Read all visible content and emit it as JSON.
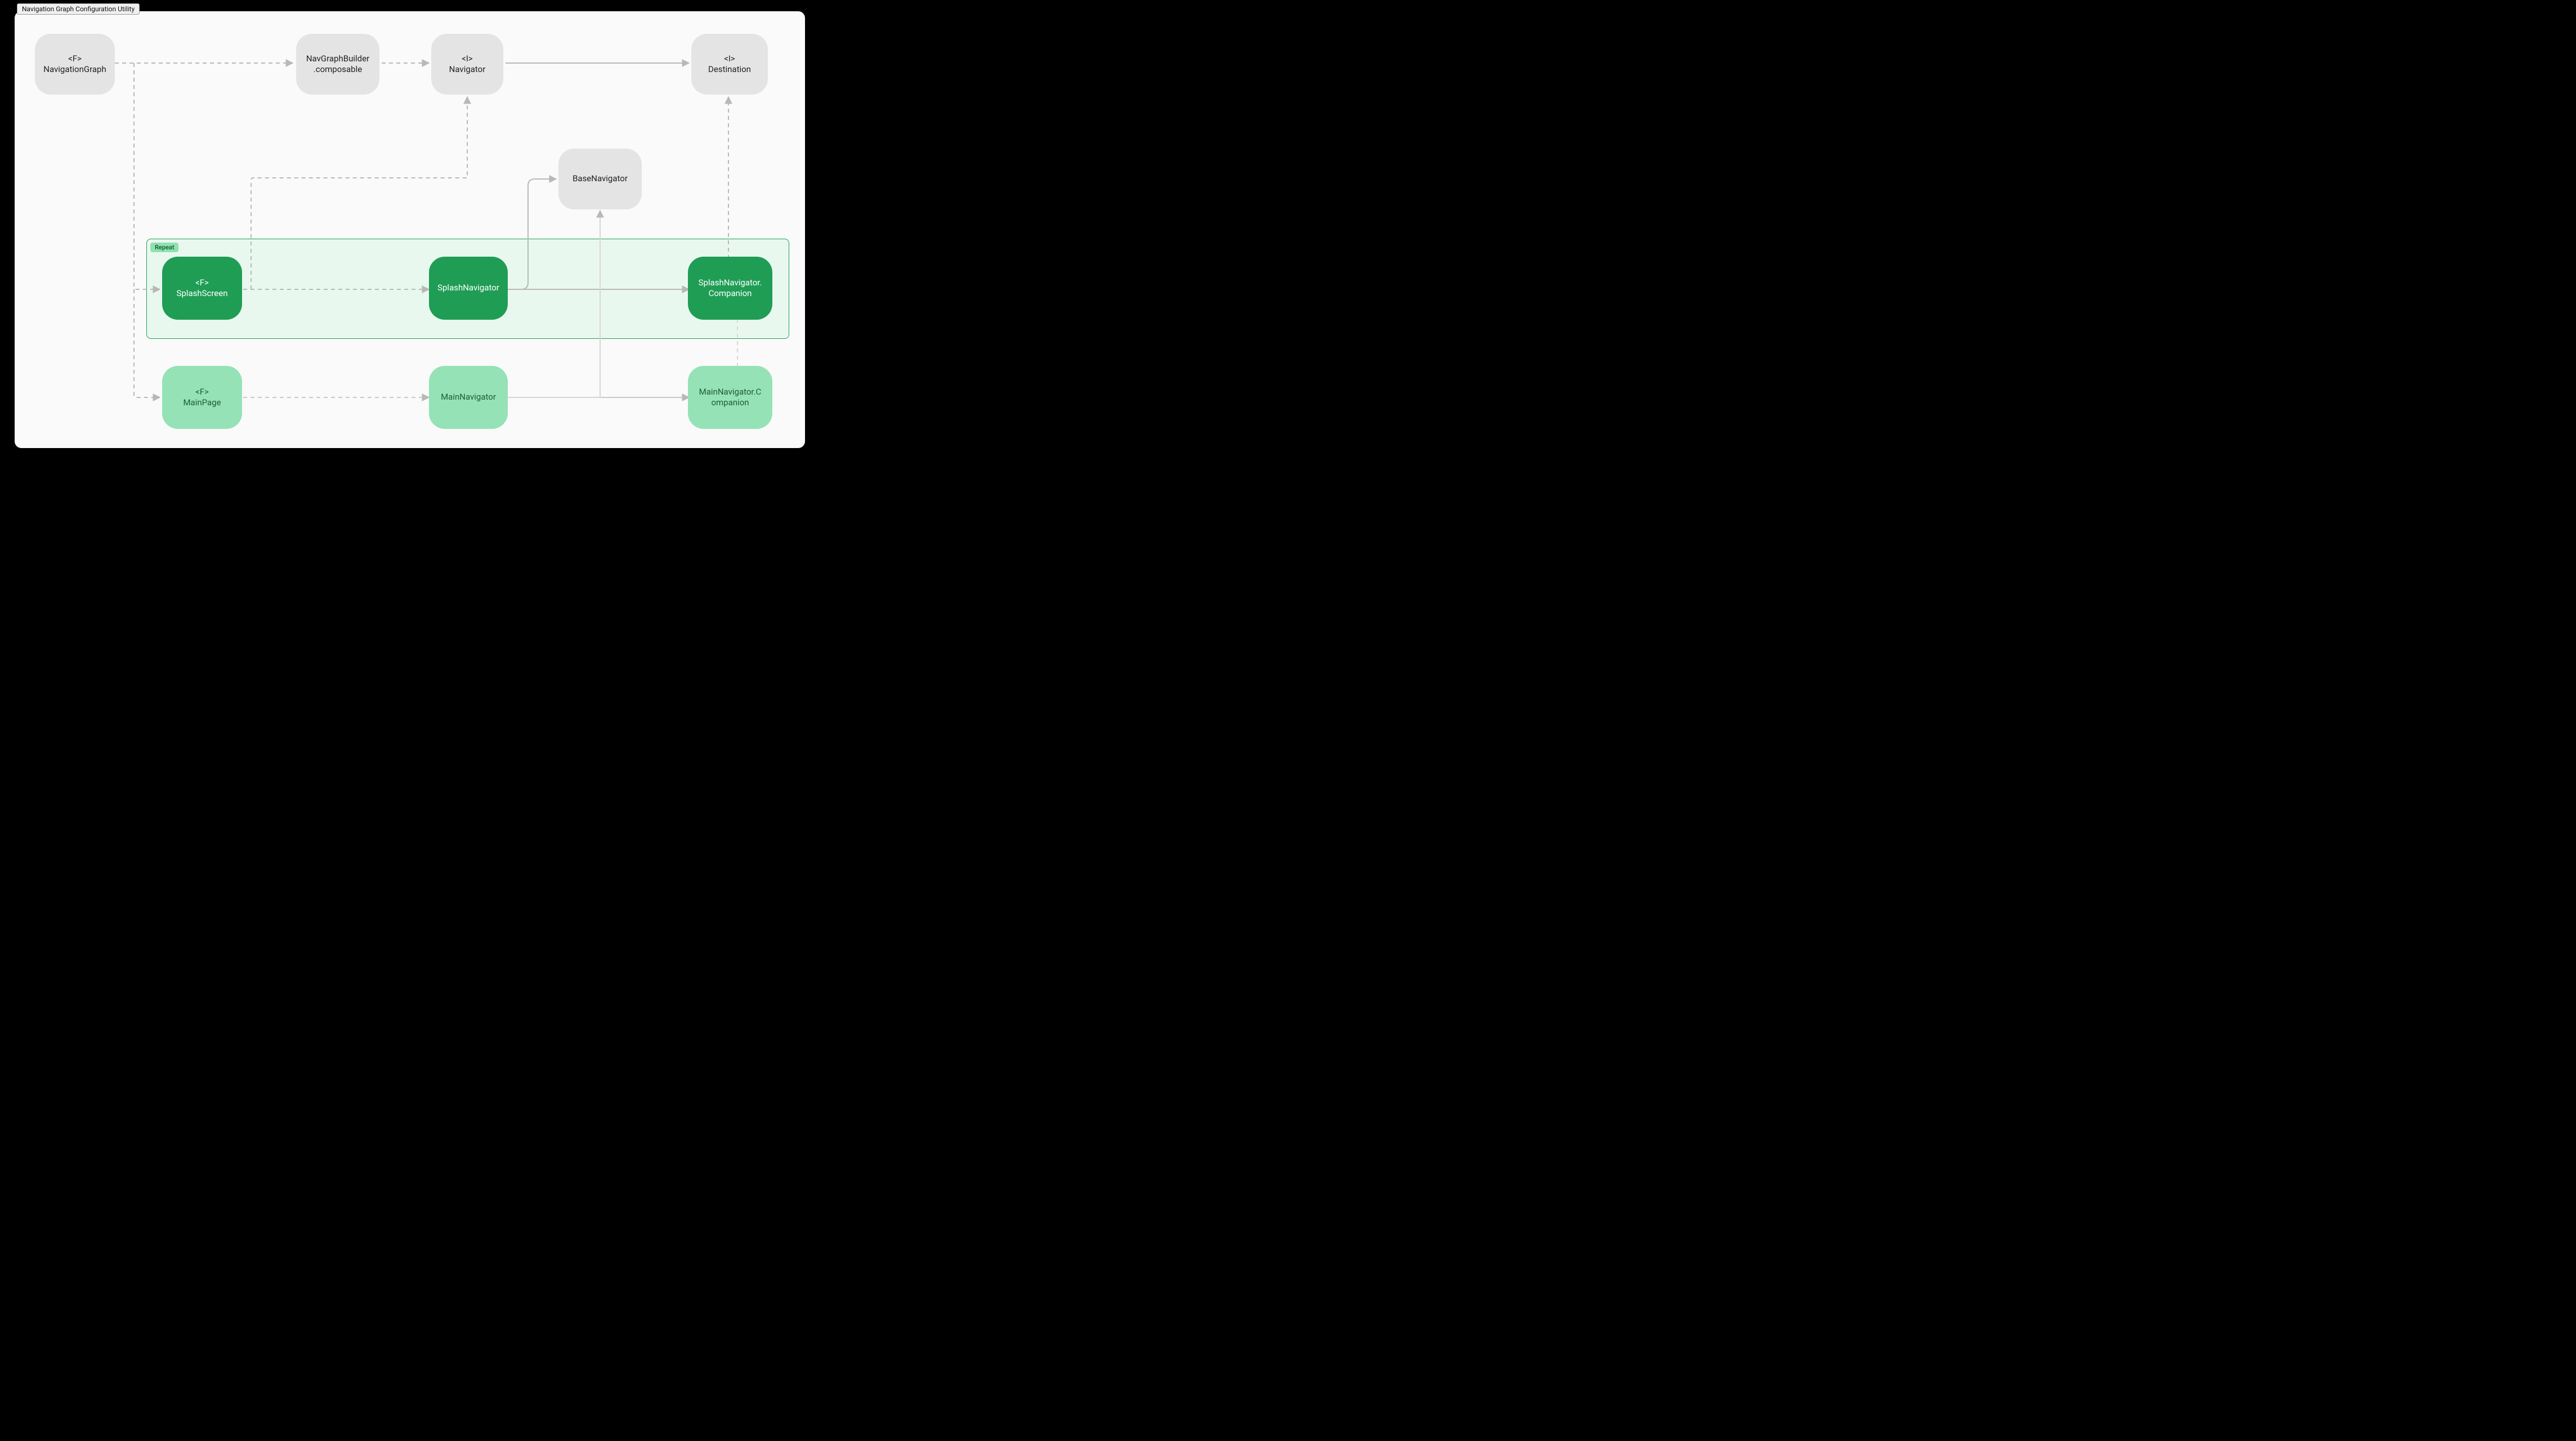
{
  "window": {
    "title": "Navigation Graph Configuration Utility"
  },
  "group": {
    "repeat_label": "Repeat"
  },
  "nodes": {
    "navgraph_tag": "<F>",
    "navgraph_name": "NavigationGraph",
    "builder_line1": "NavGraphBuilder",
    "builder_line2": ".composable",
    "navigator_tag": "<I>",
    "navigator_name": "Navigator",
    "destination_tag": "<I>",
    "destination_name": "Destination",
    "basenav_name": "BaseNavigator",
    "splashscreen_tag": "<F>",
    "splashscreen_name": "SplashScreen",
    "splashnav_name": "SplashNavigator",
    "splashcomp_line1": "SplashNavigator.",
    "splashcomp_line2": "Companion",
    "mainpage_tag": "<F>",
    "mainpage_name": "MainPage",
    "mainnav_name": "MainNavigator",
    "maincomp_line1": "MainNavigator.C",
    "maincomp_line2": "ompanion"
  },
  "style": {
    "gray": "#e4e4e4",
    "green_dark": "#1f9d55",
    "green_light": "#95e2b7",
    "stroke": "#b8b8b8"
  }
}
